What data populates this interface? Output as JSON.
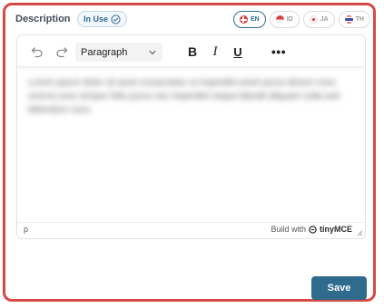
{
  "header": {
    "title": "Description",
    "badge": "In Use",
    "languages": [
      {
        "code": "EN",
        "active": true
      },
      {
        "code": "ID",
        "active": false
      },
      {
        "code": "JA",
        "active": false
      },
      {
        "code": "TH",
        "active": false
      }
    ]
  },
  "toolbar": {
    "block_format": "Paragraph",
    "bold_label": "B",
    "italic_label": "I",
    "underline_label": "U",
    "more_label": "•••"
  },
  "editor": {
    "content": "Lorem ipsum dolor sit amet consectetur ut imperdiet amet purus dictum nunc viverra nunc tempor felis purus nec imperdiet neque blandit aliquam nulla sed bibendum nunc."
  },
  "statusbar": {
    "path": "p",
    "build_with": "Build with",
    "brand": "tinyMCE"
  },
  "footer": {
    "save_label": "Save"
  },
  "colors": {
    "frame_border": "#d54a44",
    "accent": "#2f6b8c"
  }
}
